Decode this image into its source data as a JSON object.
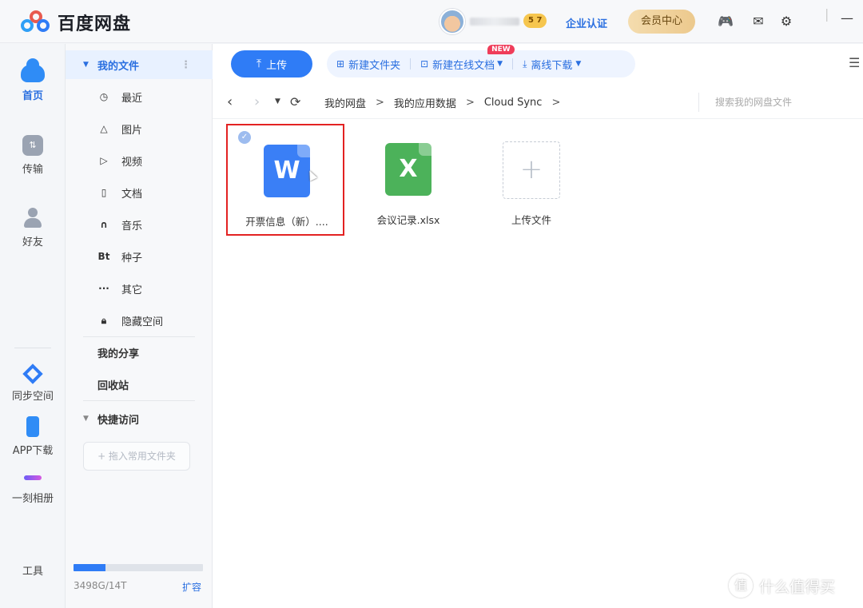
{
  "app": {
    "logo_text": "百度网盘"
  },
  "header": {
    "level_badge": "5 7",
    "enterprise_label": "企业认证",
    "vip_label": "会员中心",
    "icons": [
      "gamepad-icon",
      "mail-icon",
      "settings-icon"
    ]
  },
  "rail": {
    "items": [
      {
        "label": "首页",
        "icon": "cloud-icon",
        "active": true
      },
      {
        "label": "传输",
        "icon": "transfer-icon"
      },
      {
        "label": "好友",
        "icon": "friends-icon"
      },
      {
        "label": "同步空间",
        "icon": "sync-icon"
      },
      {
        "label": "APP下载",
        "icon": "phone-icon"
      },
      {
        "label": "一刻相册",
        "icon": "album-icon"
      },
      {
        "label": "工具",
        "icon": "tools-icon"
      }
    ]
  },
  "sidebar": {
    "my_files": "我的文件",
    "items": [
      {
        "label": "最近",
        "icon": "clock-icon"
      },
      {
        "label": "图片",
        "icon": "image-icon"
      },
      {
        "label": "视频",
        "icon": "play-icon"
      },
      {
        "label": "文档",
        "icon": "document-icon"
      },
      {
        "label": "音乐",
        "icon": "headphones-icon"
      },
      {
        "label": "种子",
        "icon": "bt-icon",
        "glyph": "Bt"
      },
      {
        "label": "其它",
        "icon": "more-icon"
      },
      {
        "label": "隐藏空间",
        "icon": "lock-icon"
      }
    ],
    "my_share": "我的分享",
    "recycle": "回收站",
    "quick_access": "快捷访问",
    "quick_placeholder": "+ 拖入常用文件夹",
    "storage_text": "3498G/14T",
    "storage_used_fraction": 0.244,
    "expand_label": "扩容"
  },
  "toolbar": {
    "upload": "上传",
    "new_folder": "新建文件夹",
    "new_online_doc": "新建在线文档",
    "new_badge": "NEW",
    "offline_download": "离线下载"
  },
  "path": {
    "crumbs": [
      "我的网盘",
      "我的应用数据",
      "Cloud Sync"
    ],
    "search_placeholder": "搜索我的网盘文件"
  },
  "files": [
    {
      "name": "开票信息（新）....",
      "type": "word",
      "glyph": "W",
      "selected": true
    },
    {
      "name": "会议记录.xlsx",
      "type": "excel",
      "glyph": "X",
      "selected": false
    }
  ],
  "upload_tile": {
    "label": "上传文件"
  },
  "watermark": {
    "text": "什么值得买",
    "glyph": "值"
  },
  "colors": {
    "accent": "#2f7cf6",
    "selection": "#e32222",
    "excel": "#4cb25a",
    "word": "#3a7ff6"
  }
}
